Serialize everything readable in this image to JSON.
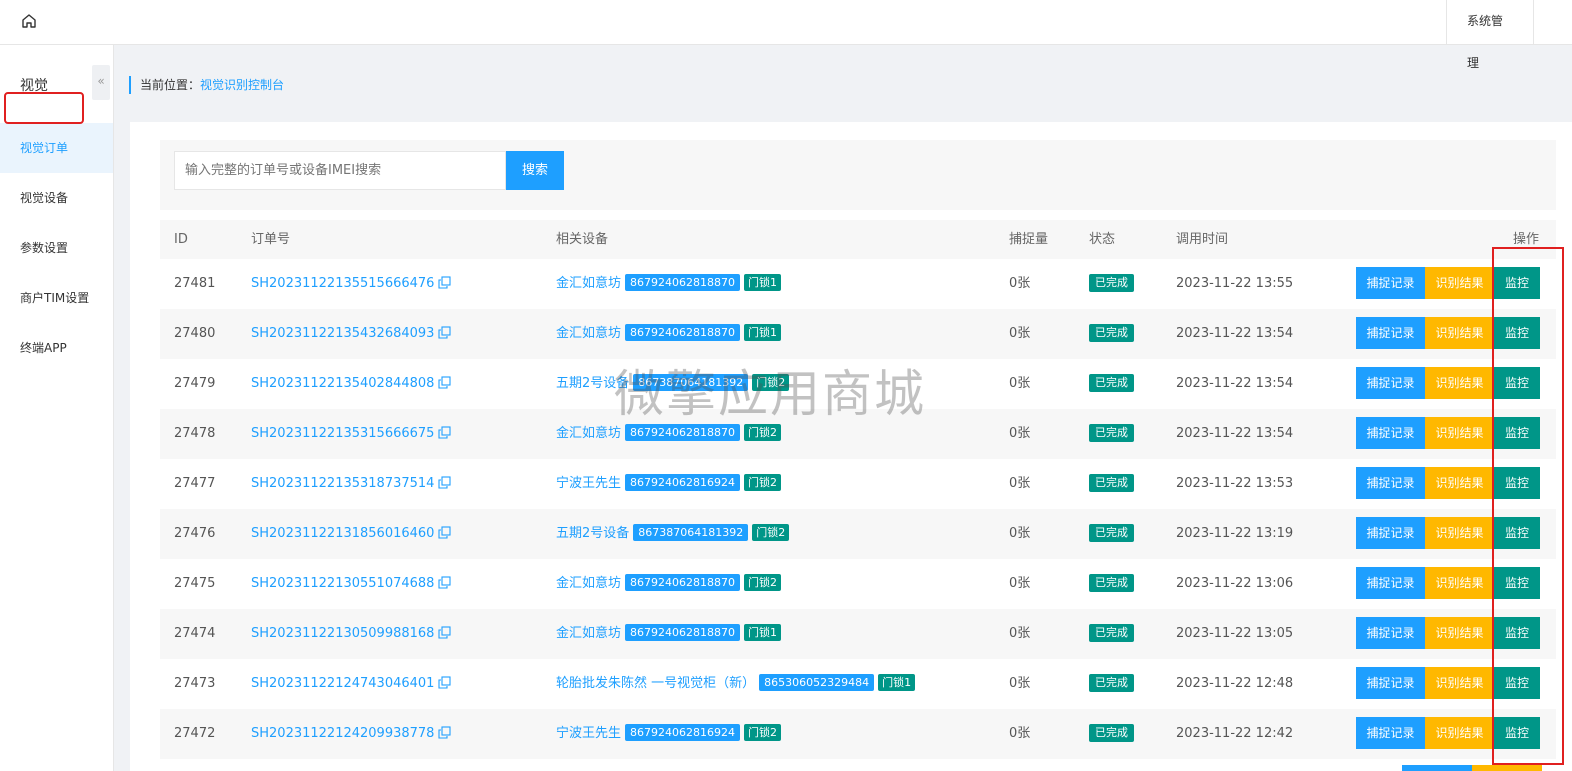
{
  "topbar": {
    "menu": [
      "系统管理"
    ]
  },
  "sidebar": {
    "title": "视觉",
    "collapse_glyph": "«",
    "items": [
      {
        "label": "视觉订单",
        "active": true
      },
      {
        "label": "视觉设备",
        "active": false
      },
      {
        "label": "参数设置",
        "active": false
      },
      {
        "label": "商户TIM设置",
        "active": false
      },
      {
        "label": "终端APP",
        "active": false
      }
    ]
  },
  "breadcrumb": {
    "prefix": "当前位置：",
    "current": "视觉识别控制台"
  },
  "search": {
    "placeholder": "输入完整的订单号或设备IMEI搜索",
    "button": "搜索"
  },
  "table": {
    "headers": [
      "ID",
      "订单号",
      "相关设备",
      "捕捉量",
      "状态",
      "调用时间",
      "操作"
    ],
    "actions": {
      "capture": "捕捉记录",
      "result": "识别结果",
      "monitor": "监控"
    },
    "rows": [
      {
        "id": "27481",
        "order": "SH20231122135515666476",
        "device": "金汇如意坊",
        "imei": "867924062818870",
        "lock": "门锁1",
        "count": "0张",
        "status": "已完成",
        "time": "2023-11-22 13:55"
      },
      {
        "id": "27480",
        "order": "SH20231122135432684093",
        "device": "金汇如意坊",
        "imei": "867924062818870",
        "lock": "门锁1",
        "count": "0张",
        "status": "已完成",
        "time": "2023-11-22 13:54"
      },
      {
        "id": "27479",
        "order": "SH20231122135402844808",
        "device": "五期2号设备",
        "imei": "867387064181392",
        "lock": "门锁2",
        "count": "0张",
        "status": "已完成",
        "time": "2023-11-22 13:54"
      },
      {
        "id": "27478",
        "order": "SH20231122135315666675",
        "device": "金汇如意坊",
        "imei": "867924062818870",
        "lock": "门锁2",
        "count": "0张",
        "status": "已完成",
        "time": "2023-11-22 13:54"
      },
      {
        "id": "27477",
        "order": "SH20231122135318737514",
        "device": "宁波王先生",
        "imei": "867924062816924",
        "lock": "门锁2",
        "count": "0张",
        "status": "已完成",
        "time": "2023-11-22 13:53"
      },
      {
        "id": "27476",
        "order": "SH20231122131856016460",
        "device": "五期2号设备",
        "imei": "867387064181392",
        "lock": "门锁2",
        "count": "0张",
        "status": "已完成",
        "time": "2023-11-22 13:19"
      },
      {
        "id": "27475",
        "order": "SH20231122130551074688",
        "device": "金汇如意坊",
        "imei": "867924062818870",
        "lock": "门锁2",
        "count": "0张",
        "status": "已完成",
        "time": "2023-11-22 13:06"
      },
      {
        "id": "27474",
        "order": "SH20231122130509988168",
        "device": "金汇如意坊",
        "imei": "867924062818870",
        "lock": "门锁1",
        "count": "0张",
        "status": "已完成",
        "time": "2023-11-22 13:05"
      },
      {
        "id": "27473",
        "order": "SH20231122124743046401",
        "device": "轮胎批发朱陈然 一号视觉柜（新）",
        "imei": "865306052329484",
        "lock": "门锁1",
        "count": "0张",
        "status": "已完成",
        "time": "2023-11-22 12:48"
      },
      {
        "id": "27472",
        "order": "SH20231122124209938778",
        "device": "宁波王先生",
        "imei": "867924062816924",
        "lock": "门锁2",
        "count": "0张",
        "status": "已完成",
        "time": "2023-11-22 12:42"
      }
    ]
  },
  "watermark": "微擎应用商城",
  "colors": {
    "primary": "#1e9fff",
    "warning": "#ffb800",
    "success": "#009688",
    "highlight": "#e02020"
  }
}
